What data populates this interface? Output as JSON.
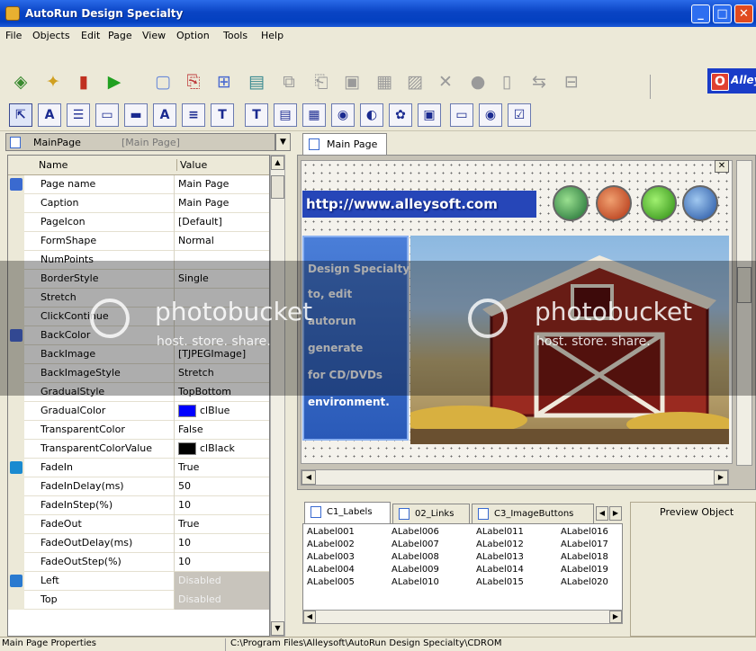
{
  "window": {
    "title": "AutoRun Design Specialty"
  },
  "menu": [
    "File",
    "Objects",
    "Edit",
    "Page",
    "View",
    "Option",
    "Tools",
    "Help"
  ],
  "toolbar": {
    "brand_text": "Alleysoft",
    "power_symbol": "O"
  },
  "toolbar2": {
    "buttons": [
      "⇱",
      "A",
      "☰",
      "▭",
      "▬",
      "A",
      "≡",
      "T",
      "T",
      "▤",
      "▦",
      "◉",
      "◐",
      "✿",
      "▣",
      "▭",
      "◉",
      "☑"
    ]
  },
  "page_selector": {
    "value": "MainPage",
    "sub": "[Main Page]"
  },
  "prop_grid": {
    "header_name": "Name",
    "header_value": "Value",
    "rows": [
      {
        "name": "Page name",
        "value": "Main Page",
        "icon": "page-icon"
      },
      {
        "name": "Caption",
        "value": "Main Page"
      },
      {
        "name": "PageIcon",
        "value": "[Default]"
      },
      {
        "name": "FormShape",
        "value": "Normal"
      },
      {
        "name": "NumPoints",
        "value": ""
      },
      {
        "name": "BorderStyle",
        "value": "Single"
      },
      {
        "name": "Stretch",
        "value": ""
      },
      {
        "name": "ClickContinue",
        "value": ""
      },
      {
        "name": "BackColor",
        "value": "",
        "icon": "palette-icon"
      },
      {
        "name": "BackImage",
        "value": "[TJPEGImage]"
      },
      {
        "name": "BackImageStyle",
        "value": "Stretch"
      },
      {
        "name": "GradualStyle",
        "value": "TopBottom"
      },
      {
        "name": "GradualColor",
        "value": "clBlue",
        "swatch": "#0000ff"
      },
      {
        "name": "TransparentColor",
        "value": "False"
      },
      {
        "name": "TransparentColorValue",
        "value": "clBlack",
        "swatch": "#000000"
      },
      {
        "name": "FadeIn",
        "value": "True",
        "icon": "fade-icon"
      },
      {
        "name": "FadeInDelay(ms)",
        "value": "50"
      },
      {
        "name": "FadeInStep(%)",
        "value": "10"
      },
      {
        "name": "FadeOut",
        "value": "True"
      },
      {
        "name": "FadeOutDelay(ms)",
        "value": "10"
      },
      {
        "name": "FadeOutStep(%)",
        "value": "10"
      },
      {
        "name": "Left",
        "value": "Disabled",
        "icon": "refresh-icon",
        "disabled": true
      },
      {
        "name": "Top",
        "value": "Disabled",
        "disabled": true
      }
    ]
  },
  "designer": {
    "tab_label": "Main Page",
    "site_url": "http://www.alleysoft.com",
    "info_lines": [
      "Design Specialty",
      "to, edit",
      "autorun",
      "generate",
      "for CD/DVDs",
      "environment."
    ]
  },
  "object_tabs": [
    "C1_Labels",
    "02_Links",
    "C3_ImageButtons"
  ],
  "labels": [
    "ALabel001",
    "ALabel006",
    "ALabel011",
    "ALabel016",
    "ALabel002",
    "ALabel007",
    "ALabel012",
    "ALabel017",
    "ALabel003",
    "ALabel008",
    "ALabel013",
    "ALabel018",
    "ALabel004",
    "ALabel009",
    "ALabel014",
    "ALabel019",
    "ALabel005",
    "ALabel010",
    "ALabel015",
    "ALabel020"
  ],
  "preview": {
    "label": "Preview Object"
  },
  "watermark": {
    "brand": "photobucket",
    "sub": "host. store. share."
  },
  "status": {
    "left": "Main Page Properties",
    "right": "C:\\Program Files\\Alleysoft\\AutoRun Design Specialty\\CDROM"
  },
  "colors": {
    "titlebar": "#0a44c4",
    "accent": "#2646b8"
  }
}
